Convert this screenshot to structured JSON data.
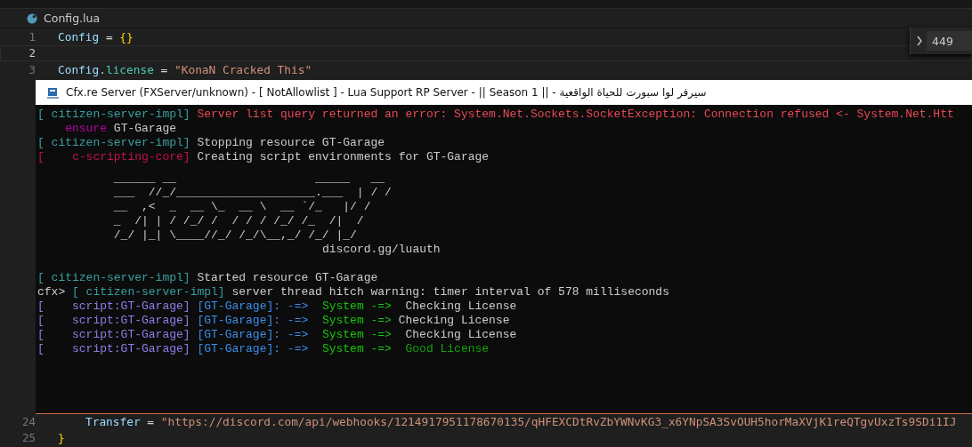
{
  "editor": {
    "tab": {
      "label": "Config.lua",
      "selected": true
    },
    "top_lines": [
      {
        "number": "1",
        "current": false,
        "tokens": [
          {
            "text": "Config",
            "kind": "var"
          },
          {
            "text": " = ",
            "kind": "op"
          },
          {
            "text": "{}",
            "kind": "brace"
          }
        ]
      },
      {
        "number": "2",
        "current": true
      },
      {
        "number": "3",
        "current": false,
        "tokens": [
          {
            "text": "Config",
            "kind": "var"
          },
          {
            "text": ".",
            "kind": "op"
          },
          {
            "text": "license",
            "kind": "field"
          },
          {
            "text": " = ",
            "kind": "op"
          },
          {
            "text": "\"KonaN Cracked This\"",
            "kind": "string"
          }
        ]
      }
    ],
    "bottom_lines": [
      {
        "number": "24",
        "current": false,
        "indent": true,
        "tokens": [
          {
            "text": "Transfer",
            "kind": "var"
          },
          {
            "text": " = ",
            "kind": "op"
          },
          {
            "text": "\"https://discord.com/api/webhooks/1214917951178670135/qHFEXCDtRvZbYWNvKG3_x6YNpSA3SvOUH5horMaXVjK1reQTgvUxzTs9SDi1IJ",
            "kind": "string"
          }
        ]
      },
      {
        "number": "25",
        "current": false,
        "indent": false,
        "tokens": [
          {
            "text": "}",
            "kind": "brace"
          }
        ]
      }
    ],
    "goto_line": {
      "value": "449"
    }
  },
  "console": {
    "title": "Cfx.re Server (FXServer/unknown) - [ NotAllowlist ] - Lua Support RP Server - || Season 1 || - سيرفر لوا سبورت للحياة الواقعية",
    "lines_before": [
      {
        "segments": [
          {
            "text": "[ citizen-server-impl] ",
            "kind": "tag"
          },
          {
            "text": "Server list query returned an error: System.Net.Sockets.SocketException: Connection refused <- System.Net.Htt",
            "kind": "error"
          }
        ]
      },
      {
        "segments": [
          {
            "text": "    ensure ",
            "kind": "ensure"
          },
          {
            "text": "GT-Garage",
            "kind": "plain"
          }
        ]
      },
      {
        "segments": [
          {
            "text": "[ citizen-server-impl] ",
            "kind": "tag"
          },
          {
            "text": "Stopping resource GT-Garage",
            "kind": "plain"
          }
        ]
      },
      {
        "segments": [
          {
            "text": "[    c-scripting-core] ",
            "kind": "core"
          },
          {
            "text": "Creating script environments for GT-Garage",
            "kind": "plain"
          }
        ]
      }
    ],
    "ascii_art": [
      "           ______ __                    _____   __",
      "           ___  //_/____________________.___  | / /",
      "           __  ,<  _  __ \\_  __ \\  __ `/_   |/ /",
      "           _  /| | / /_/ /  / / / /_/ /_  /|  /",
      "           /_/ |_| \\____//_/ /_/\\__,_/ /_/ |_/"
    ],
    "art_caption": "discord.gg/luauth",
    "lines_after": [
      {
        "segments": [
          {
            "text": "[ citizen-server-impl] ",
            "kind": "tag"
          },
          {
            "text": "Started resource GT-Garage",
            "kind": "plain"
          }
        ]
      },
      {
        "segments": [
          {
            "text": "cfx> ",
            "kind": "plain"
          },
          {
            "text": "[ citizen-server-impl] ",
            "kind": "tag"
          },
          {
            "text": "server thread hitch warning: timer interval of 578 milliseconds",
            "kind": "plain"
          }
        ]
      },
      {
        "segments": [
          {
            "text": "[    script:GT-Garage] ",
            "kind": "script"
          },
          {
            "text": "[GT-Garage]: -=>  ",
            "kind": "resource"
          },
          {
            "text": "System -=>  ",
            "kind": "system"
          },
          {
            "text": "Checking License",
            "kind": "plain"
          }
        ]
      },
      {
        "segments": [
          {
            "text": "[    script:GT-Garage] ",
            "kind": "script"
          },
          {
            "text": "[GT-Garage]: -=>  ",
            "kind": "resource"
          },
          {
            "text": "System -=> ",
            "kind": "system"
          },
          {
            "text": "Checking License",
            "kind": "plain"
          }
        ]
      },
      {
        "segments": [
          {
            "text": "[    script:GT-Garage] ",
            "kind": "script"
          },
          {
            "text": "[GT-Garage]: -=>  ",
            "kind": "resource"
          },
          {
            "text": "System -=>  ",
            "kind": "system"
          },
          {
            "text": "Checking License",
            "kind": "plain"
          }
        ]
      },
      {
        "segments": [
          {
            "text": "[    script:GT-Garage] ",
            "kind": "script"
          },
          {
            "text": "[GT-Garage]: -=>  ",
            "kind": "resource"
          },
          {
            "text": "System -=>  ",
            "kind": "system"
          },
          {
            "text": "Good License",
            "kind": "good"
          }
        ]
      }
    ]
  }
}
